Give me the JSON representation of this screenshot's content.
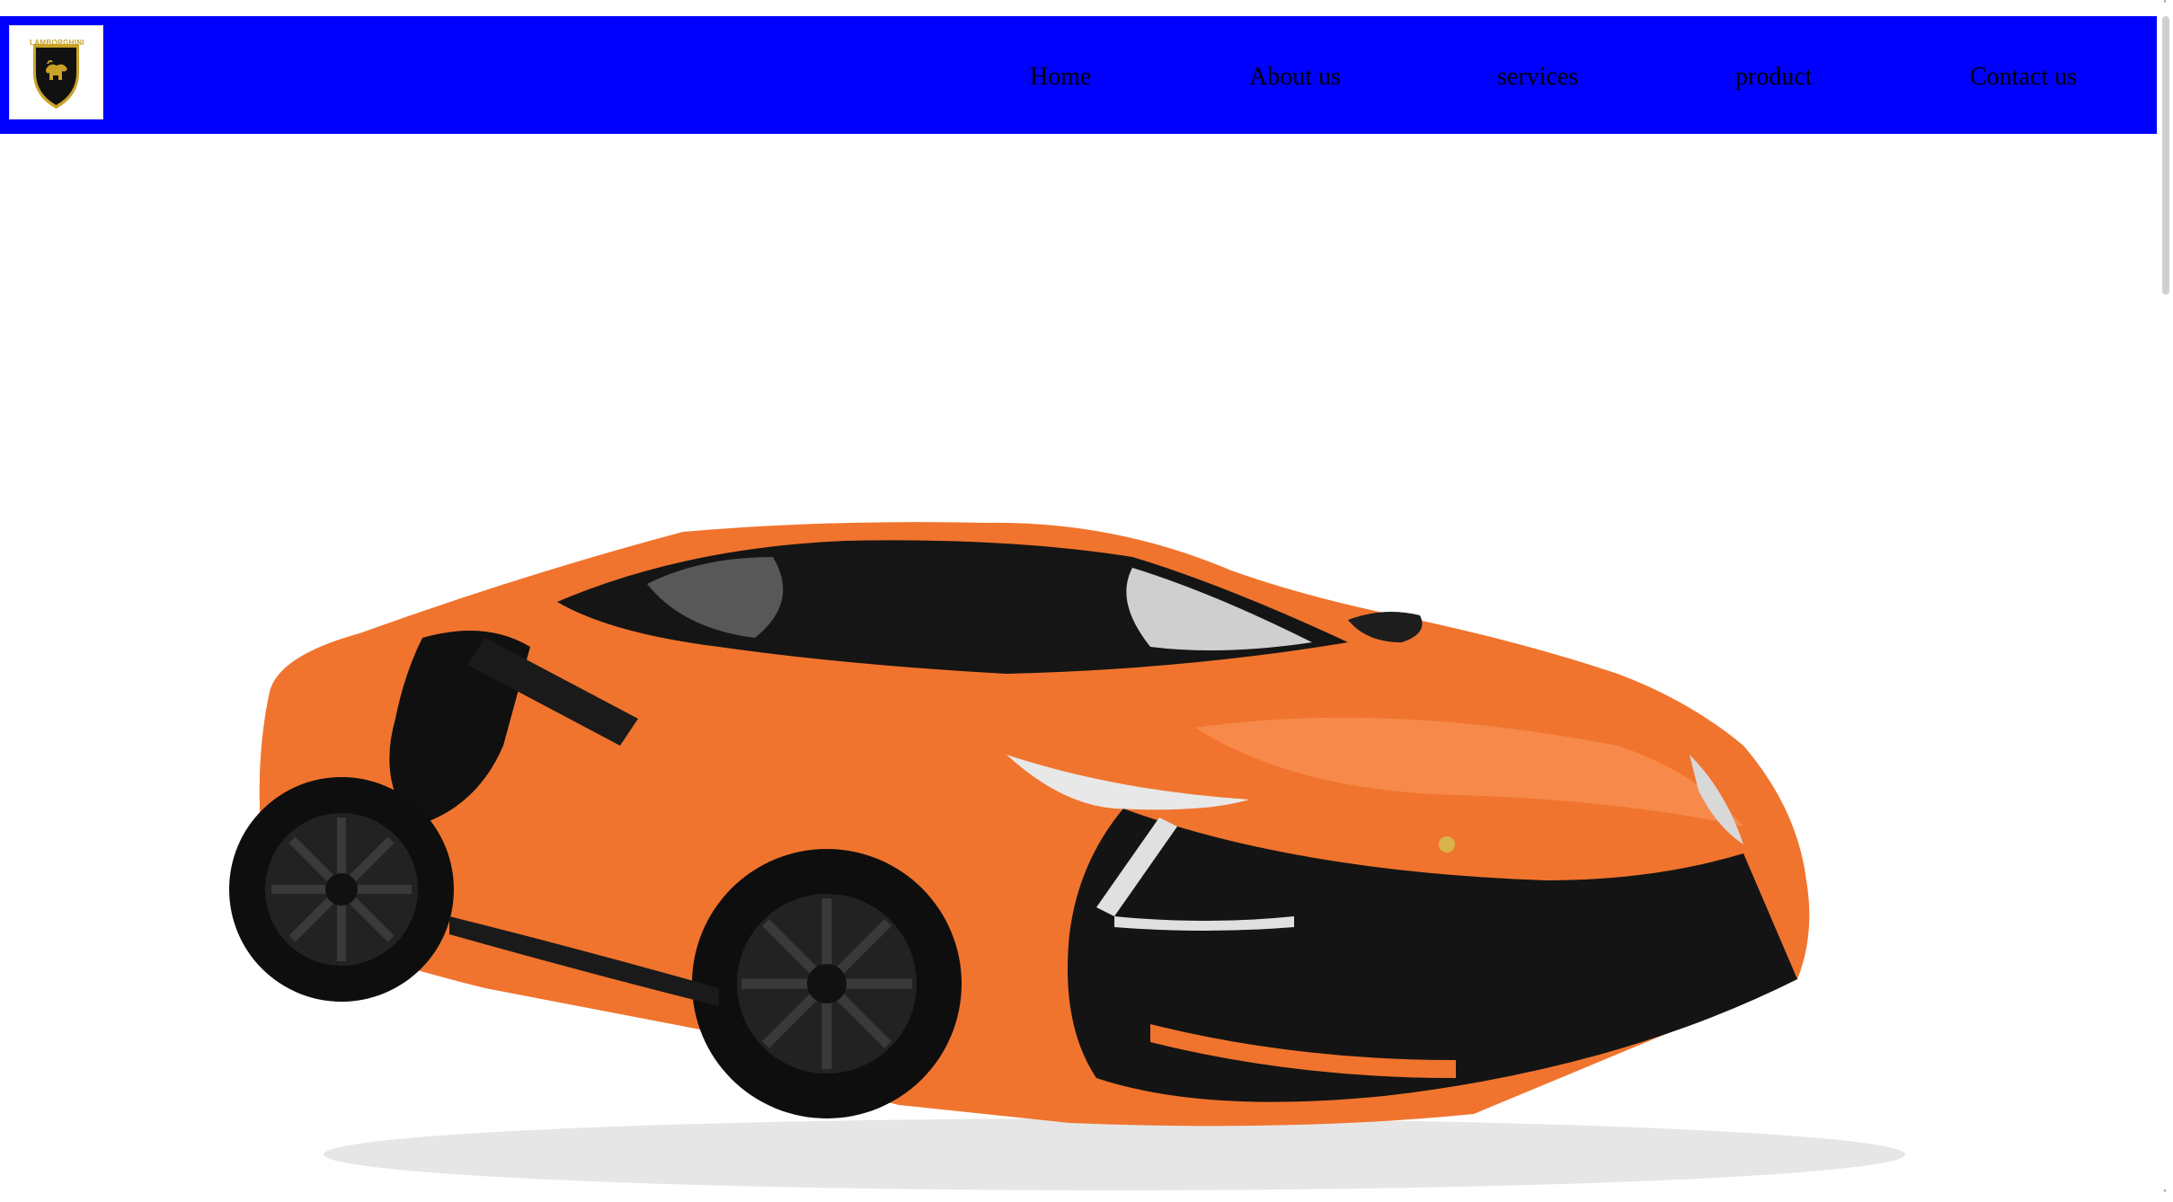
{
  "brand": {
    "logo_text": "LAMBORGHINI",
    "logo_icon": "bull-shield-icon",
    "colors": {
      "navbar": "#0000ff",
      "shield_black": "#111111",
      "shield_gold": "#c9a227",
      "car_orange": "#f0742e"
    }
  },
  "nav": {
    "items": [
      {
        "label": "Home"
      },
      {
        "label": "About us"
      },
      {
        "label": "services"
      },
      {
        "label": "product"
      },
      {
        "label": "Contact us"
      }
    ]
  },
  "hero": {
    "image": "orange-lamborghini-revuelto-image"
  },
  "scrollbar": {
    "up_glyph": "˄",
    "down_glyph": "˅"
  }
}
